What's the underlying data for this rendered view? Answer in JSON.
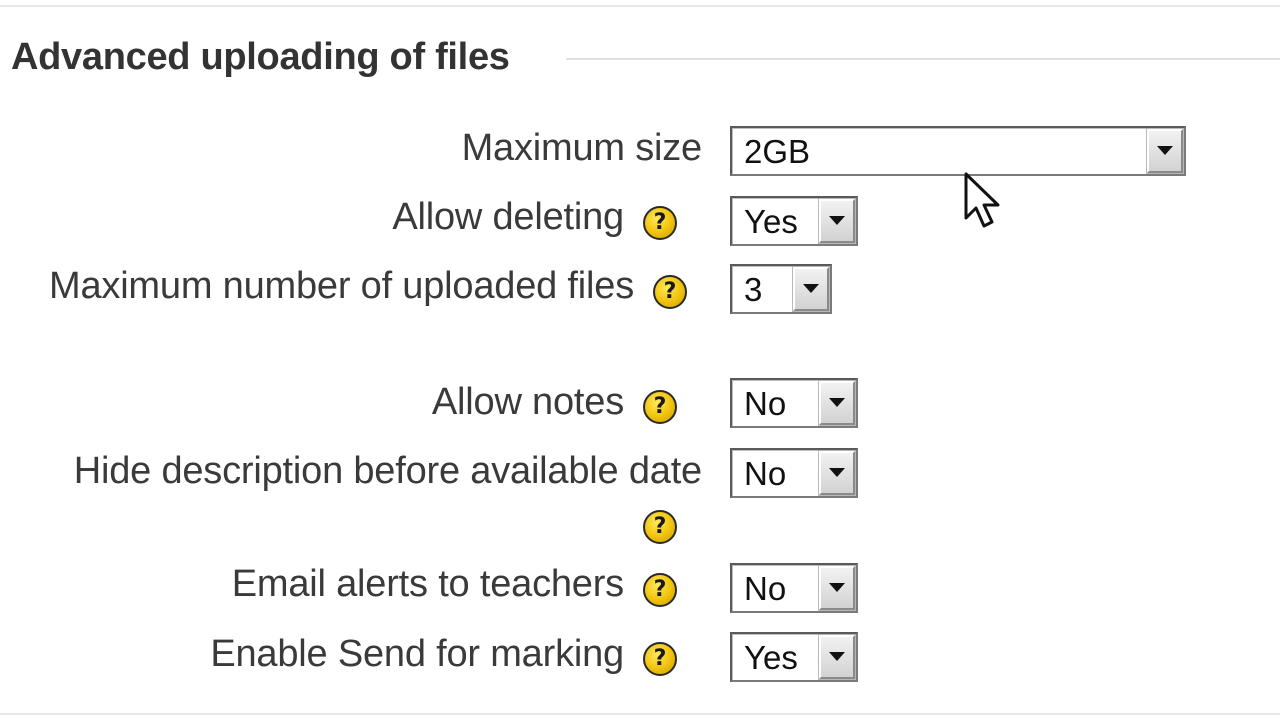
{
  "section": {
    "title": "Advanced uploading of files"
  },
  "fields": [
    {
      "label": "Maximum size",
      "value": "2GB",
      "help_icon": false
    },
    {
      "label": "Allow deleting",
      "value": "Yes",
      "help_icon": "help-icon"
    },
    {
      "label": "Maximum number of uploaded files",
      "value": "3",
      "help_icon": "help-icon"
    },
    {
      "label": "Allow notes",
      "value": "No",
      "help_icon": "help-icon"
    },
    {
      "label": "Hide description before available date",
      "value": "No",
      "help_icon": "help-icon"
    },
    {
      "label": "Email alerts to teachers",
      "value": "No",
      "help_icon": "help-icon"
    },
    {
      "label": "Enable Send for marking",
      "value": "Yes",
      "help_icon": "help-icon"
    }
  ],
  "icons": {
    "help": "?",
    "help_color": "#f0c20a",
    "dropdown": "chevron-down-icon",
    "cursor": "mouse-pointer-icon"
  }
}
